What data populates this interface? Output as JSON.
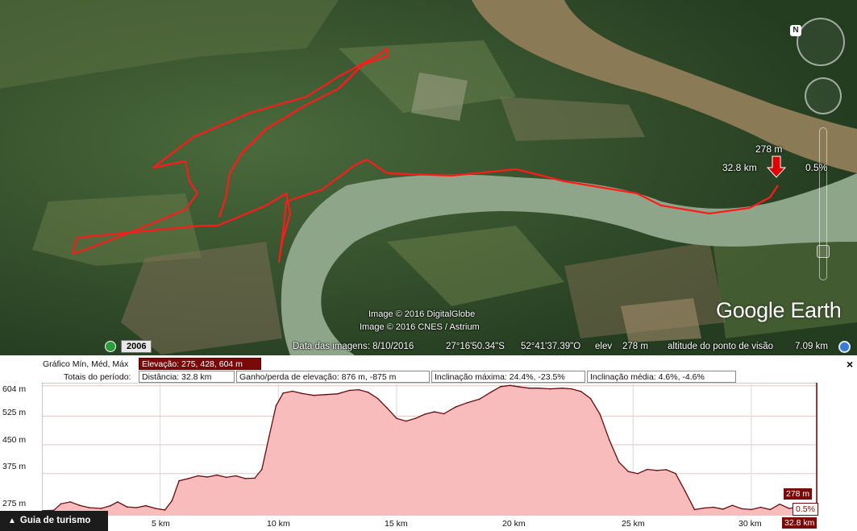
{
  "map": {
    "credits": [
      "Image © 2016 DigitalGlobe",
      "Image © 2016 CNES / Astrium"
    ],
    "logo": "Google Earth",
    "historical_year": "2006",
    "marker": {
      "elevation": "278 m",
      "distance": "32.8 km",
      "slope": "0.5%"
    },
    "status": {
      "imagery_date": "Data das imagens: 8/10/2016",
      "lat": "27°16'50.34\"S",
      "lon": "52°41'37.39\"O",
      "elev_label": "elev",
      "elev_value": "278 m",
      "eye_label": "altitude do ponto de visão",
      "eye_value": "7.09 km"
    },
    "icons": {
      "compass": "north-arrow-icon",
      "history": "clock-icon",
      "altitude": "sun-icon"
    }
  },
  "profile": {
    "row1": {
      "label": "Gráfico  Mín, Méd, Máx",
      "value": "Elevação: 275, 428, 604 m"
    },
    "row2": {
      "label": "Totais do período:",
      "distance": "Distância: 32.8 km",
      "gain_loss": "Ganho/perda de elevação: 876 m, -875 m",
      "max_slope": "Inclinação máxima: 24.4%, -23.5%",
      "avg_slope": "Inclinação média: 4.6%, -4.6%"
    },
    "close_label": "×",
    "tour_guide": "Guia de turismo",
    "cursor": {
      "elevation": "278 m",
      "slope": "0.5%",
      "distance": "32.8 km"
    }
  },
  "chart_data": {
    "type": "area",
    "title": "",
    "xlabel": "",
    "ylabel": "",
    "ylim": [
      265,
      612
    ],
    "xlim": [
      0,
      32.8
    ],
    "y_ticks": [
      "604 m",
      "525 m",
      "450 m",
      "375 m",
      "275 m"
    ],
    "y_tick_values": [
      604,
      525,
      450,
      375,
      275
    ],
    "x_ticks": [
      "5 km",
      "10 km",
      "15 km",
      "20 km",
      "25 km",
      "30 km"
    ],
    "x_tick_values": [
      5,
      10,
      15,
      20,
      25,
      30
    ],
    "x": [
      0,
      0.5,
      0.8,
      1.2,
      1.6,
      2,
      2.5,
      2.9,
      3.2,
      3.6,
      4,
      4.4,
      4.8,
      5.2,
      5.5,
      5.8,
      6.2,
      6.6,
      7,
      7.4,
      7.8,
      8.2,
      8.6,
      9,
      9.3,
      9.6,
      9.9,
      10.2,
      10.6,
      11,
      11.5,
      12,
      12.5,
      13,
      13.4,
      13.8,
      14.2,
      14.6,
      15,
      15.4,
      15.8,
      16.2,
      16.6,
      17,
      17.5,
      18,
      18.5,
      19,
      19.4,
      19.8,
      20.2,
      20.6,
      21,
      21.5,
      22,
      22.4,
      22.8,
      23.2,
      23.6,
      24,
      24.4,
      24.8,
      25.2,
      25.6,
      26,
      26.4,
      26.8,
      27.2,
      27.6,
      28,
      28.4,
      28.8,
      29.2,
      29.6,
      30,
      30.4,
      30.8,
      31.2,
      31.6,
      32,
      32.4,
      32.8
    ],
    "values": [
      278,
      279,
      296,
      301,
      292,
      286,
      284,
      291,
      301,
      288,
      286,
      291,
      284,
      280,
      304,
      356,
      362,
      369,
      366,
      371,
      365,
      369,
      362,
      363,
      386,
      470,
      552,
      585,
      590,
      584,
      579,
      581,
      583,
      592,
      594,
      587,
      571,
      546,
      519,
      512,
      519,
      530,
      536,
      531,
      549,
      560,
      569,
      588,
      602,
      605,
      601,
      598,
      598,
      596,
      598,
      596,
      589,
      571,
      530,
      462,
      405,
      380,
      375,
      386,
      383,
      385,
      375,
      329,
      281,
      285,
      287,
      282,
      292,
      283,
      281,
      287,
      281,
      295,
      284,
      288,
      288,
      278
    ],
    "grid": true,
    "legend": "none",
    "fill_color": "#f8bcbc",
    "line_color": "#6a0a0a"
  },
  "colors": {
    "track": "#ff1a1a",
    "accent_dark_red": "#7a0a0a",
    "river": "#8fa58a",
    "brown_river": "#8a7a55"
  }
}
